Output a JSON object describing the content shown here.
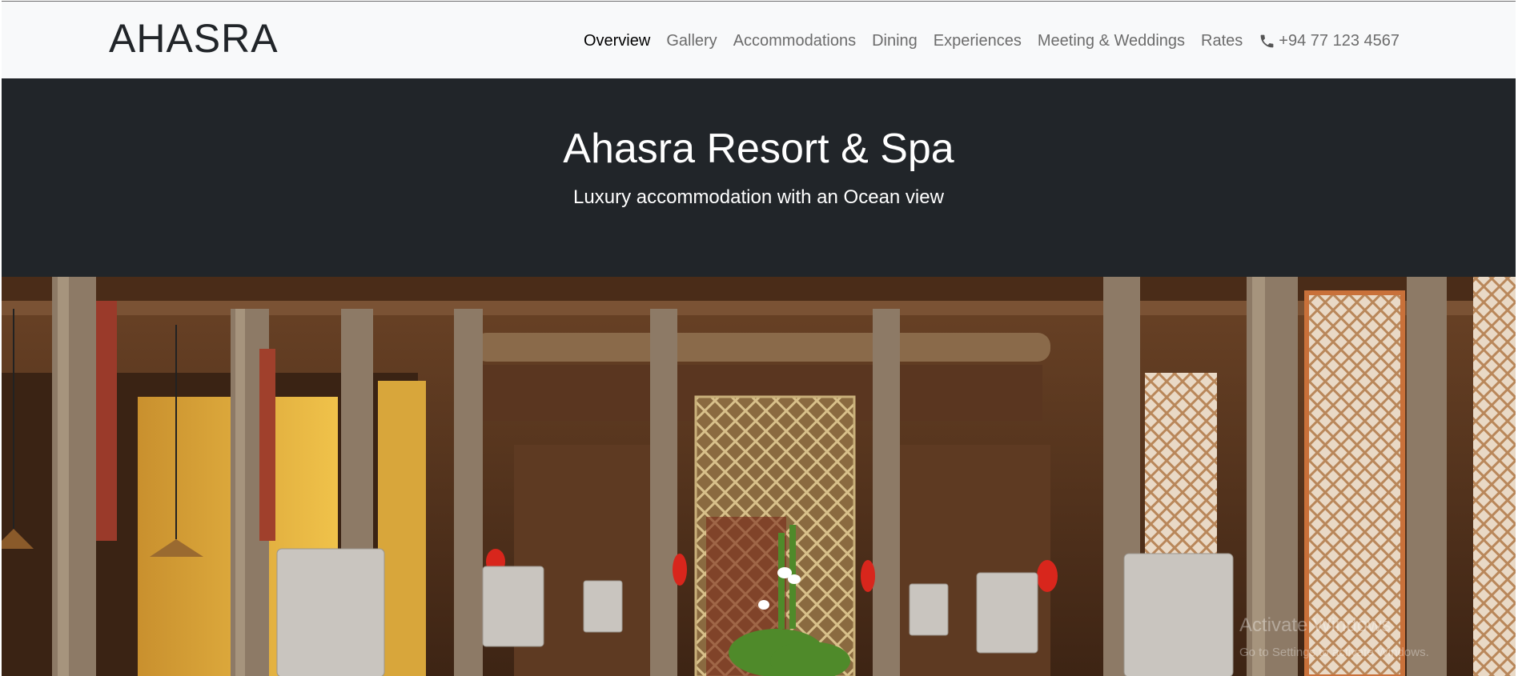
{
  "navbar": {
    "brand": "AHASRA",
    "links": [
      {
        "label": "Overview",
        "active": true
      },
      {
        "label": "Gallery"
      },
      {
        "label": "Accommodations"
      },
      {
        "label": "Dining"
      },
      {
        "label": "Experiences"
      },
      {
        "label": "Meeting & Weddings"
      },
      {
        "label": "Rates"
      }
    ],
    "phone": "+94 77 123 4567",
    "phone_icon": "phone-icon",
    "colors": {
      "background": "#f8f9fa",
      "active": "#000000",
      "link": "#6c6c6c"
    }
  },
  "hero": {
    "title": "Ahasra Resort & Spa",
    "subtitle": "Luxury accommodation with an Ocean view",
    "background": "#212529"
  },
  "photo": {
    "watermark": {
      "title": "Activate Windows",
      "subtitle": "Go to Settings to activate Windows."
    }
  }
}
